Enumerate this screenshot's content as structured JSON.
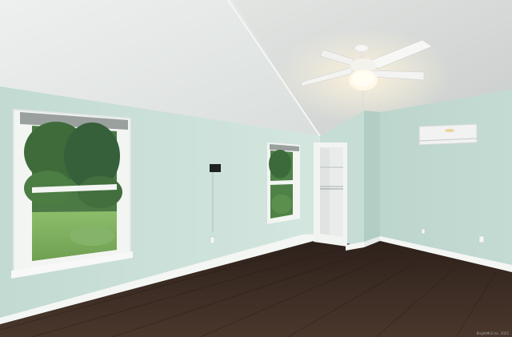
{
  "photo": {
    "subject": "empty bedroom",
    "credit": "BrightMLS Inc. 2025"
  },
  "colors": {
    "wall": "#c9ded6",
    "ceiling": "#e9eceb",
    "floor": "#3a2a22",
    "trim": "#f2f4f2",
    "grass": "#7fb060",
    "foliage": "#3f6b3b"
  },
  "objects": [
    "vaulted-ceiling",
    "ceiling-fan-light",
    "left-window",
    "middle-window",
    "closet-doorway",
    "wall-mounted-ac-unit",
    "tv-wall-mount",
    "hardwood-floor",
    "baseboards"
  ]
}
